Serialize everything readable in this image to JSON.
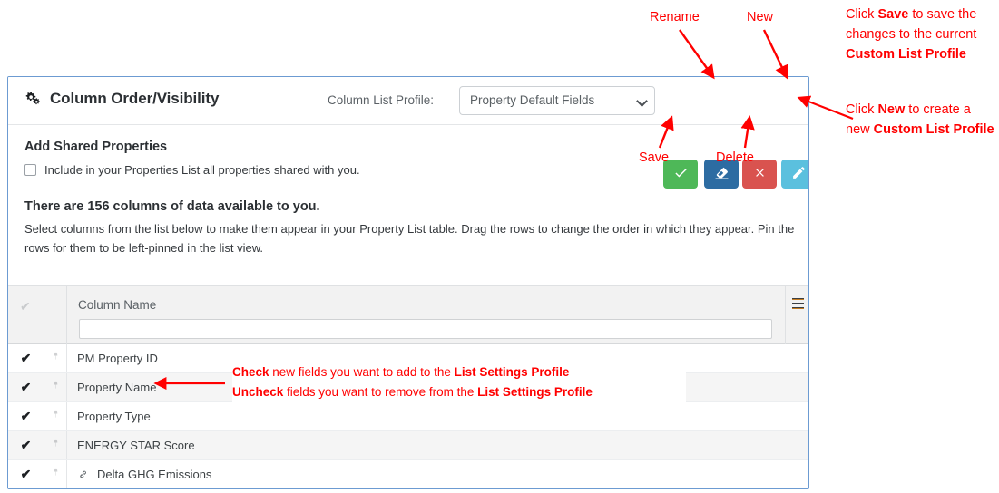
{
  "panel": {
    "title": "Column Order/Visibility",
    "title_icon": "cogs-icon",
    "profile_label": "Column List Profile:",
    "profile_value": "Property Default Fields",
    "buttons": [
      {
        "name": "save",
        "icon": "check-icon",
        "color": "#4eb858",
        "tooltip": "Save"
      },
      {
        "name": "rename",
        "icon": "eraser-icon",
        "color": "#2d6ca2",
        "tooltip": "Rename"
      },
      {
        "name": "delete",
        "icon": "close-icon",
        "color": "#d9534f",
        "tooltip": "Delete"
      },
      {
        "name": "new",
        "icon": "pencil-icon",
        "color": "#5bc0de",
        "tooltip": "New"
      }
    ]
  },
  "shared": {
    "heading": "Add Shared Properties",
    "checkbox_label": "Include in your Properties List all properties shared with you.",
    "checked": false
  },
  "columns_info": {
    "heading": "There are 156 columns of data available to you.",
    "body": "Select columns from the list below to make them appear in your Property List table. Drag the rows to change the order in which they appear. Pin the rows for them to be left-pinned in the list view."
  },
  "grid": {
    "header": {
      "select_all_icon": "check-icon",
      "column_name": "Column Name",
      "filter_value": "",
      "menu_icon": "hamburger-menu-icon"
    },
    "rows": [
      {
        "checked": true,
        "pinned": false,
        "linked": false,
        "name": "PM Property ID"
      },
      {
        "checked": true,
        "pinned": false,
        "linked": false,
        "name": "Property Name"
      },
      {
        "checked": true,
        "pinned": false,
        "linked": false,
        "name": "Property Type"
      },
      {
        "checked": true,
        "pinned": false,
        "linked": false,
        "name": "ENERGY STAR Score"
      },
      {
        "checked": true,
        "pinned": false,
        "linked": true,
        "name": "Delta GHG Emissions"
      }
    ]
  },
  "annotations": {
    "color": "#ff0000",
    "rename": "Rename",
    "new": "New",
    "save": "Save",
    "delete": "Delete",
    "save_block": {
      "p1": "Click ",
      "b1": "Save",
      "p2": " to save the changes to the current ",
      "b2": "Custom List Profile"
    },
    "new_block": {
      "p1": "Click ",
      "b1": "New",
      "p2": " to create a new ",
      "b2": "Custom List Profile"
    },
    "check_block": {
      "l1b1": "Check",
      "l1p1": " new fields you want to add to the ",
      "l1b2": "List Settings Profile",
      "l2b1": "Uncheck",
      "l2p1": " fields you want to remove from the ",
      "l2b2": "List Settings Profile"
    }
  }
}
